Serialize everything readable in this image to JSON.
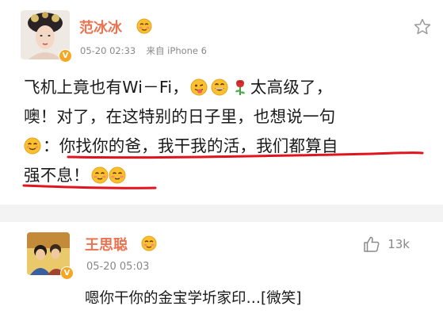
{
  "post": {
    "author": "范冰冰",
    "timestamp": "05-20 02:33",
    "source": "来自 iPhone 6",
    "verified_badge": "V",
    "lines": [
      {
        "before": "飞机上竟也有Wi－Fi，",
        "after": "太高级了，"
      },
      {
        "text": "噢！对了，在这特别的日子里，也想说一句"
      },
      {
        "text": "：你找你的爸，我干我的活，我们都算自"
      },
      {
        "text": "强不息！"
      }
    ],
    "icons": [
      "favorite-star-icon",
      "tongue-emoji-icon",
      "grin-emoji-icon",
      "rose-emoji-icon",
      "smile-emoji-icon",
      "blush-emoji-icon"
    ],
    "annotation_color": "#e0141e"
  },
  "reply": {
    "author": "王思聪",
    "timestamp": "05-20 05:03",
    "verified_badge": "V",
    "like_count": "13k",
    "text": "嗯你干你的金宝学圻家印…[微笑]",
    "icons": [
      "thumbs-up-icon"
    ]
  },
  "colors": {
    "name": "#eb7350",
    "meta": "#888888",
    "badge": "#f5a623"
  }
}
